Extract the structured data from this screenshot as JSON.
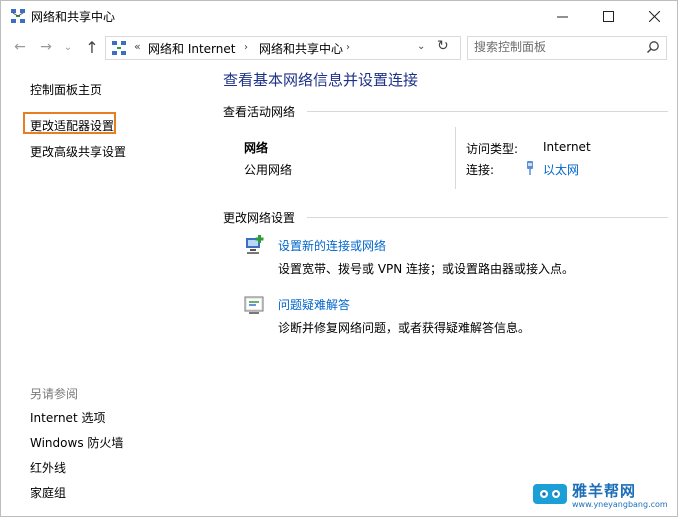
{
  "window": {
    "title": "网络和共享中心"
  },
  "address_bar": {
    "overflow": "«",
    "crumbs": [
      "网络和 Internet",
      "网络和共享中心"
    ],
    "separator": "›"
  },
  "search": {
    "placeholder": "搜索控制面板"
  },
  "sidebar": {
    "items": [
      {
        "label": "控制面板主页"
      },
      {
        "label": "更改适配器设置",
        "highlighted": true
      },
      {
        "label": "更改高级共享设置"
      }
    ],
    "see_also_title": "另请参阅",
    "see_also": [
      {
        "label": "Internet 选项"
      },
      {
        "label": "Windows 防火墙"
      },
      {
        "label": "红外线"
      },
      {
        "label": "家庭组"
      }
    ]
  },
  "main": {
    "title": "查看基本网络信息并设置连接",
    "active_networks_title": "查看活动网络",
    "network": {
      "name": "网络",
      "type": "公用网络",
      "access_type_label": "访问类型:",
      "access_type_value": "Internet",
      "connections_label": "连接:",
      "connections_value": "以太网"
    },
    "change_settings_title": "更改网络设置",
    "tasks": [
      {
        "label": "设置新的连接或网络",
        "description": "设置宽带、拨号或 VPN 连接；或设置路由器或接入点。",
        "icon": "network-setup-icon"
      },
      {
        "label": "问题疑难解答",
        "description": "诊断并修复网络问题，或者获得疑难解答信息。",
        "icon": "troubleshoot-icon"
      }
    ]
  },
  "watermark": {
    "name": "雅羊帮网",
    "url": "www.yneyangbang.com"
  },
  "colors": {
    "link": "#0066cc",
    "title": "#1e3287",
    "highlight_box": "#e67e22",
    "muted": "#7a7a7a"
  }
}
